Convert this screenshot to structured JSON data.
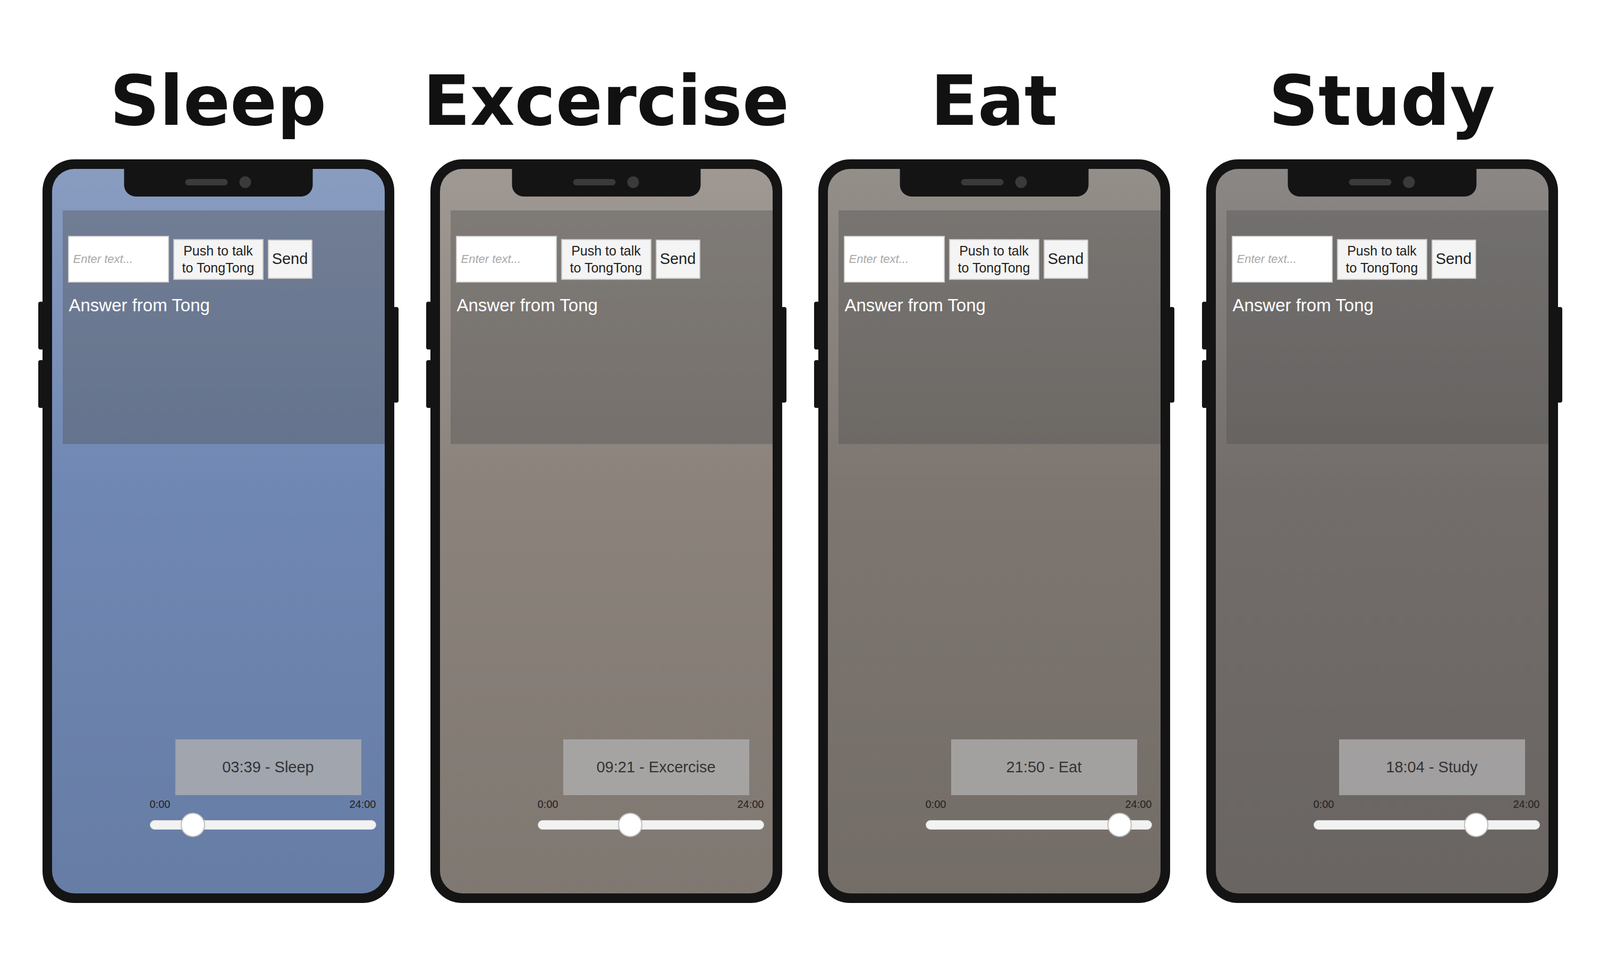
{
  "figure": {
    "panels": [
      {
        "title": "Sleep",
        "color": "#6f87b3",
        "screen": {
          "input_placeholder": "Enter text...",
          "talk_button": "Push to talk to TongTong",
          "send_button": "Send",
          "answer_label": "Answer from Tong",
          "time_label": "03:39 - Sleep",
          "slider": {
            "min_label": "0:00",
            "max_label": "24:00",
            "level": 0.19
          }
        }
      },
      {
        "title": "Excercise",
        "color": "#8a827b",
        "screen": {
          "input_placeholder": "Enter text...",
          "talk_button": "Push to talk to TongTong",
          "send_button": "Send",
          "answer_label": "Answer from Tong",
          "time_label": "09:21 - Excercise",
          "slider": {
            "min_label": "0:00",
            "max_label": "24:00",
            "level": 0.41
          }
        }
      },
      {
        "title": "Eat",
        "color": "#7d7670",
        "screen": {
          "input_placeholder": "Enter text...",
          "talk_button": "Push to talk to TongTong",
          "send_button": "Send",
          "answer_label": "Answer from Tong",
          "time_label": "21:50 - Eat",
          "slider": {
            "min_label": "0:00",
            "max_label": "24:00",
            "level": 0.86
          }
        }
      },
      {
        "title": "Study",
        "color": "#726d6a",
        "screen": {
          "input_placeholder": "Enter text...",
          "talk_button": "Push to talk to TongTong",
          "send_button": "Send",
          "answer_label": "Answer from Tong",
          "time_label": "18:04 - Study",
          "slider": {
            "min_label": "0:00",
            "max_label": "24:00",
            "level": 0.72
          }
        }
      }
    ]
  }
}
